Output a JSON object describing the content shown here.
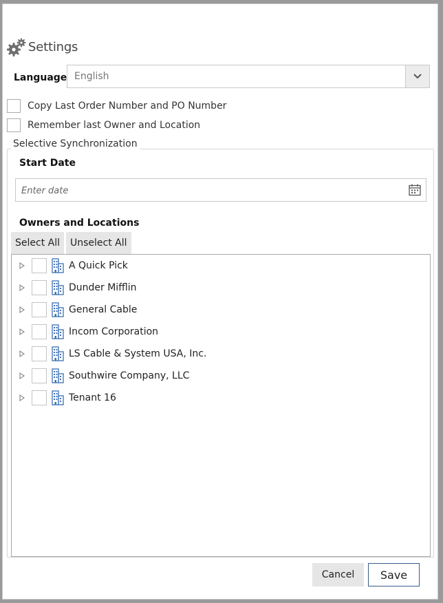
{
  "header": {
    "title": "Settings",
    "icon": "gear-icon"
  },
  "language": {
    "label": "Language",
    "selected": "English"
  },
  "options": [
    {
      "label": "Copy Last Order Number and PO Number",
      "checked": false
    },
    {
      "label": "Remember last Owner and Location",
      "checked": false
    }
  ],
  "sync": {
    "legend": "Selective Synchronization",
    "start_date_label": "Start Date",
    "date_placeholder": "Enter date",
    "owners_label": "Owners and Locations",
    "select_all": "Select All",
    "unselect_all": "Unselect All",
    "tree": [
      {
        "name": "A Quick Pick",
        "checked": false
      },
      {
        "name": "Dunder Mifflin",
        "checked": false
      },
      {
        "name": "General Cable",
        "checked": false
      },
      {
        "name": "Incom Corporation",
        "checked": false
      },
      {
        "name": "LS Cable & System USA, Inc.",
        "checked": false
      },
      {
        "name": "Southwire Company, LLC",
        "checked": false
      },
      {
        "name": "Tenant 16",
        "checked": false
      }
    ]
  },
  "footer": {
    "cancel": "Cancel",
    "save": "Save"
  },
  "colors": {
    "accent_border": "#3a5a8a",
    "button_bg": "#e6e6e6",
    "icon_blue": "#3b6fb3"
  }
}
